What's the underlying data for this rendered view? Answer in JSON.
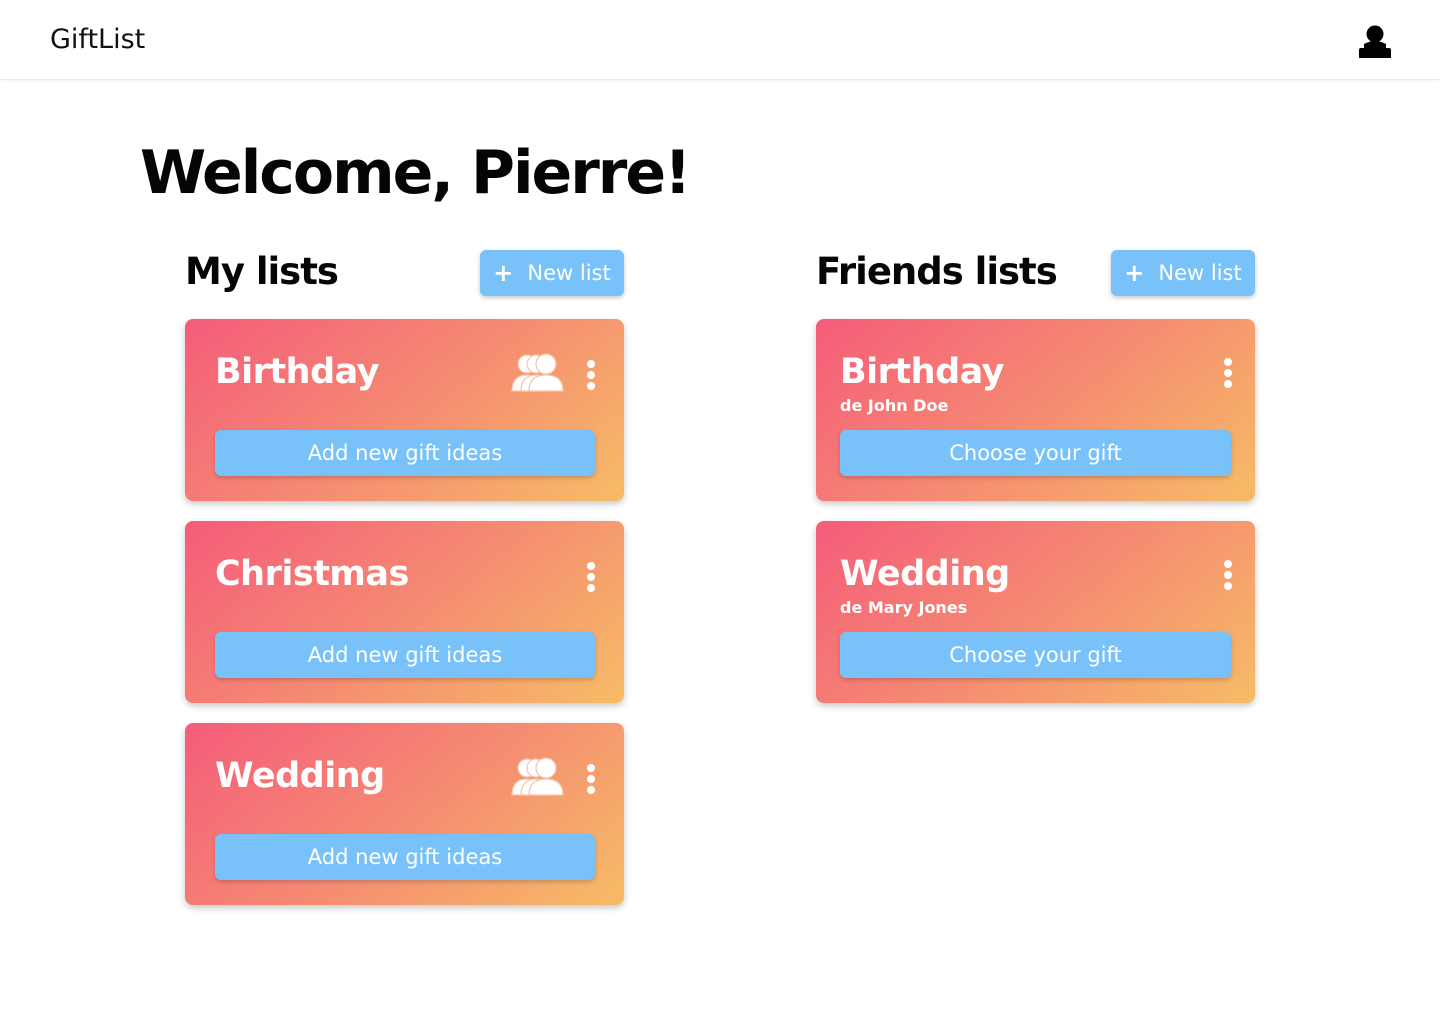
{
  "app": {
    "title": "GiftList"
  },
  "header": {
    "account_icon": "user-icon"
  },
  "welcome": "Welcome, Pierre!",
  "colors": {
    "accent": "#79c1f9",
    "card_gradient_start": "#f55c7a",
    "card_gradient_end": "#f6bc66"
  },
  "my_lists": {
    "title": "My lists",
    "new_button": {
      "icon": "plus-icon",
      "label": "New list"
    },
    "items": [
      {
        "title": "Birthday",
        "shared": true,
        "shared_icon": "people-icon",
        "action": "Add new gift ideas"
      },
      {
        "title": "Christmas",
        "shared": false,
        "action": "Add new gift ideas"
      },
      {
        "title": "Wedding",
        "shared": true,
        "shared_icon": "people-icon",
        "action": "Add new gift ideas"
      }
    ]
  },
  "friends_lists": {
    "title": "Friends lists",
    "new_button": {
      "icon": "plus-icon",
      "label": "New list"
    },
    "items": [
      {
        "title": "Birthday",
        "owner": "de John Doe",
        "action": "Choose your gift"
      },
      {
        "title": "Wedding",
        "owner": "de Mary Jones",
        "action": "Choose your gift"
      }
    ]
  }
}
